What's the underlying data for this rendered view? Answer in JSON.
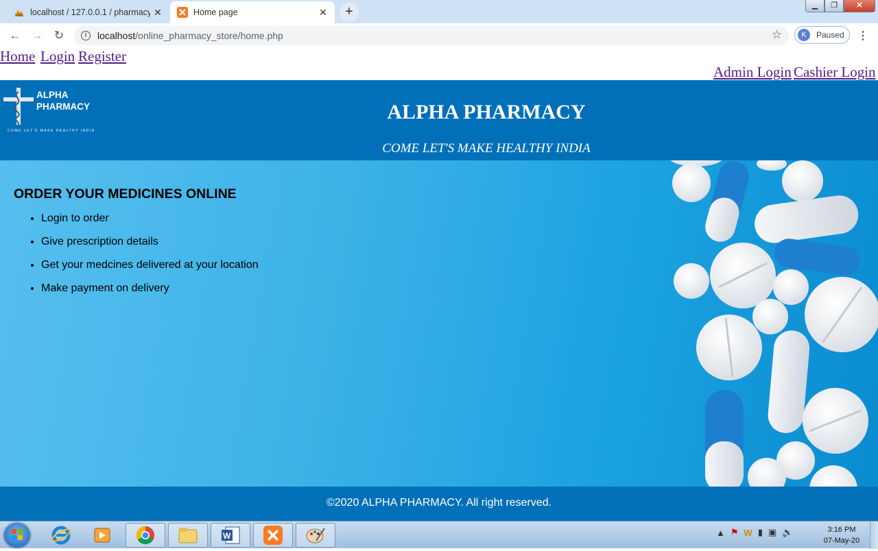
{
  "browser": {
    "tabs": [
      {
        "title": "localhost / 127.0.0.1 / pharmacy /",
        "active": false
      },
      {
        "title": "Home page",
        "active": true
      }
    ],
    "url_host": "localhost",
    "url_path": "/online_pharmacy_store/home.php",
    "profile_initial": "K",
    "profile_status": "Paused"
  },
  "nav": {
    "left_links": [
      "Home",
      "Login",
      "Register"
    ],
    "right_links": [
      "Admin Login",
      "Cashier Login"
    ]
  },
  "header": {
    "logo_line1": "ALPHA",
    "logo_line2": "PHARMACY",
    "logo_tagline": "COME LET'S MAKE HEALTHY INDIA",
    "title": "ALPHA PHARMACY",
    "tagline": "COME LET'S MAKE HEALTHY INDIA"
  },
  "hero": {
    "heading": "ORDER YOUR MEDICINES ONLINE",
    "steps": [
      "Login to order",
      "Give prescription details",
      "Get your medcines delivered at your location",
      "Make payment on delivery"
    ]
  },
  "footer": {
    "text": "©2020 ALPHA PHARMACY. All right reserved."
  },
  "taskbar": {
    "time": "3:16 PM",
    "date": "07-May-20"
  },
  "colors": {
    "header_blue": "#0170b9",
    "link_purple": "#551a8b",
    "hero_light": "#56bfee",
    "hero_dark": "#0a8bd0"
  }
}
